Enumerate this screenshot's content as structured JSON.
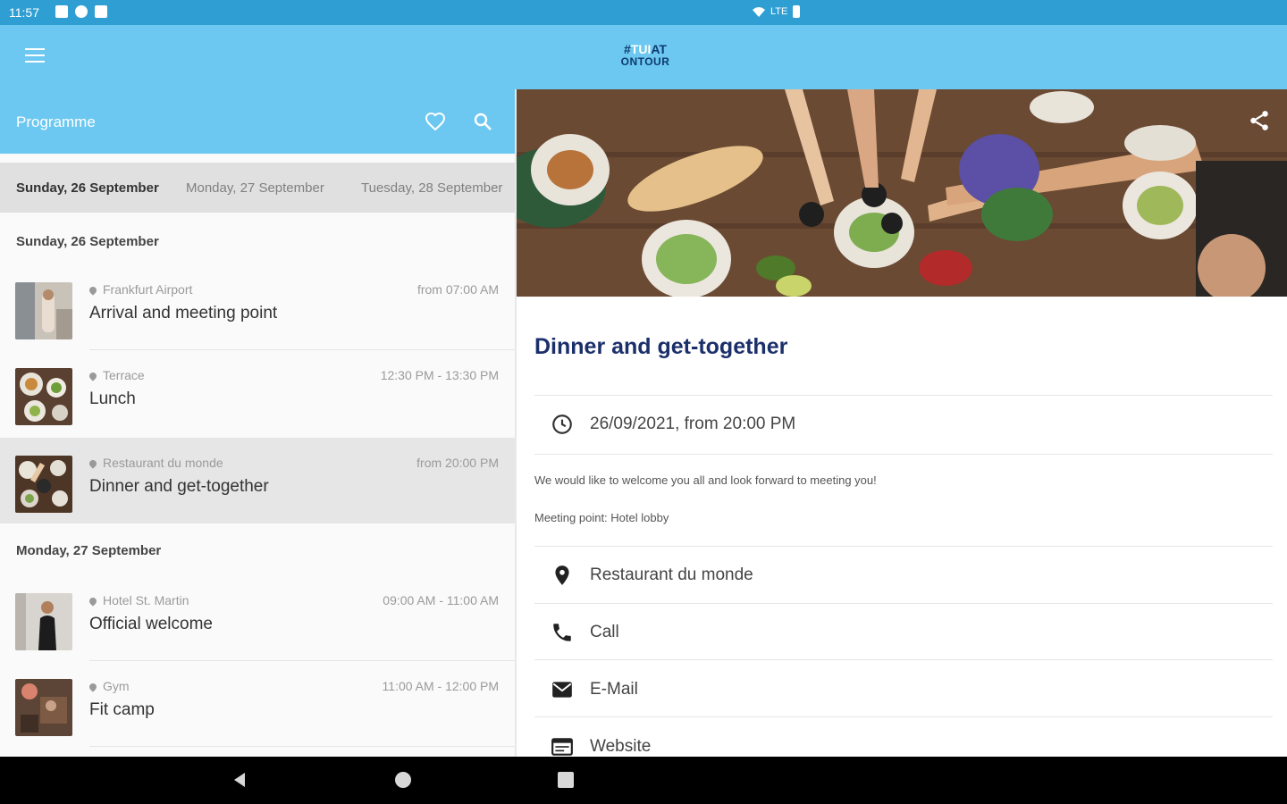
{
  "status_bar": {
    "time": "11:57",
    "network": "LTE"
  },
  "app_bar": {
    "logo_line1_a": "#",
    "logo_line1_b": "TUI",
    "logo_line1_c": "AT",
    "logo_line2": "ONTOUR"
  },
  "left_panel": {
    "title": "Programme",
    "day_tabs": [
      "Sunday, 26 September",
      "Monday, 27 September",
      "Tuesday, 28 September"
    ],
    "sections": [
      {
        "label": "Sunday, 26 September",
        "events": [
          {
            "location": "Frankfurt Airport",
            "time": "from 07:00 AM",
            "name": "Arrival and meeting point"
          },
          {
            "location": "Terrace",
            "time": "12:30 PM - 13:30 PM",
            "name": "Lunch"
          },
          {
            "location": "Restaurant du monde",
            "time": "from 20:00 PM",
            "name": "Dinner and get-together"
          }
        ]
      },
      {
        "label": "Monday, 27 September",
        "events": [
          {
            "location": "Hotel St. Martin",
            "time": "09:00 AM - 11:00 AM",
            "name": "Official welcome"
          },
          {
            "location": "Gym",
            "time": "11:00 AM - 12:00 PM",
            "name": "Fit camp"
          }
        ]
      }
    ]
  },
  "detail": {
    "title": "Dinner and get-together",
    "datetime": "26/09/2021, from 20:00 PM",
    "description_1": "We would like to welcome you all and look forward to meeting you!",
    "description_2": "Meeting point: Hotel lobby",
    "location": "Restaurant du monde",
    "call": "Call",
    "email": "E-Mail",
    "website": "Website"
  },
  "colors": {
    "status_bar": "#2f9fd3",
    "app_bar": "#6cc8f1",
    "title_navy": "#1b2f6b"
  },
  "icons": [
    "menu-icon",
    "heart-icon",
    "search-icon",
    "share-icon",
    "clock-icon",
    "location-pin-icon",
    "phone-icon",
    "mail-icon",
    "website-icon",
    "back-icon",
    "home-icon",
    "recents-icon"
  ]
}
